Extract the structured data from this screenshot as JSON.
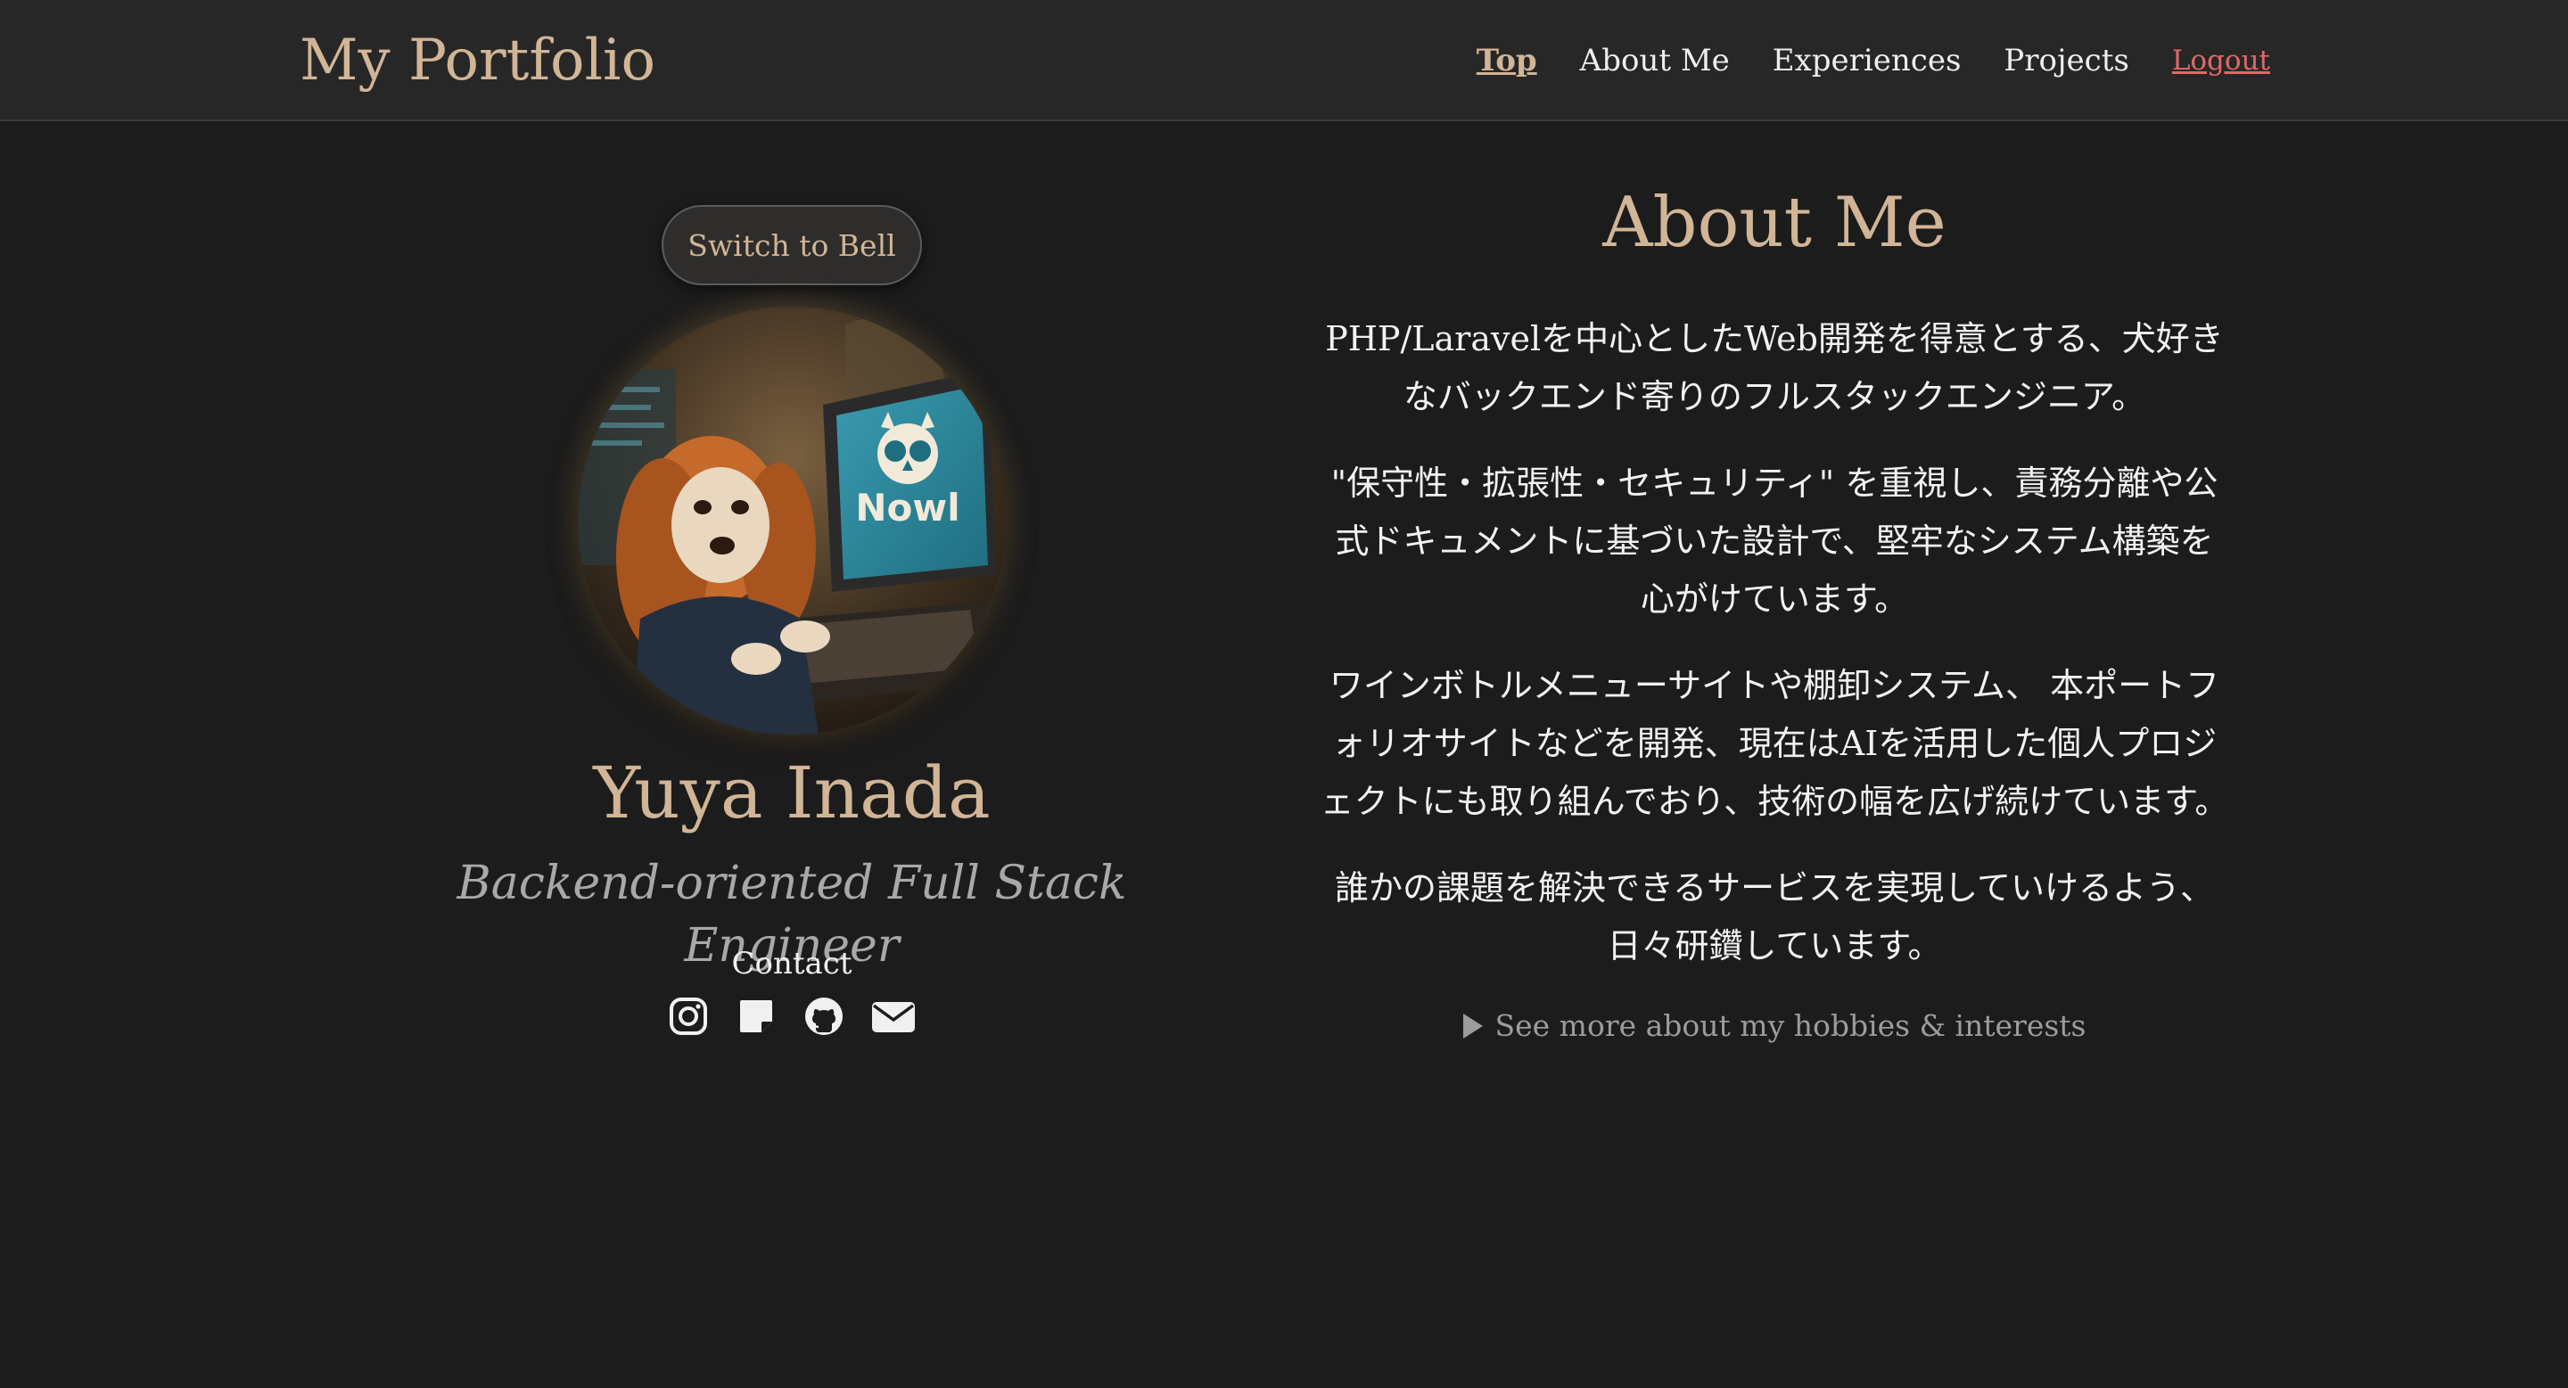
{
  "navbar": {
    "brand": "My Portfolio",
    "links": [
      {
        "label": "Top",
        "active": true
      },
      {
        "label": "About Me"
      },
      {
        "label": "Experiences"
      },
      {
        "label": "Projects"
      },
      {
        "label": "Logout"
      }
    ]
  },
  "profile": {
    "switch_button": "Switch to Bell",
    "avatar_icon": "dog-at-computer-avatar",
    "avatar_screen_text": "Nowl",
    "name": "Yuya Inada",
    "role": "Backend-oriented Full Stack Engineer",
    "contact_label": "Contact",
    "contact_icons": [
      "instagram-icon",
      "note-icon",
      "github-icon",
      "email-icon"
    ]
  },
  "about": {
    "title": "About Me",
    "paragraphs": [
      "PHP/Laravelを中心としたWeb開発を得意とする、犬好きなバックエンド寄りのフルスタックエンジニア。",
      "\"保守性・拡張性・セキュリティ\" を重視し、責務分離や公式ドキュメントに基づいた設計で、堅牢なシステム構築を心がけています。",
      "ワインボトルメニューサイトや棚卸システム、 本ポートフォリオサイトなどを開発、現在はAIを活用した個人プロジェクトにも取り組んでおり、技術の幅を広げ続けています。",
      "誰かの課題を解決できるサービスを実現していけるよう、日々研鑽しています。"
    ],
    "hobbies_toggle": "See more about my hobbies & interests"
  },
  "colors": {
    "background": "#1c1c1c",
    "navbar": "#272727",
    "accent": "#d1b596",
    "logout": "#e06868",
    "muted": "#9c9c9c"
  }
}
